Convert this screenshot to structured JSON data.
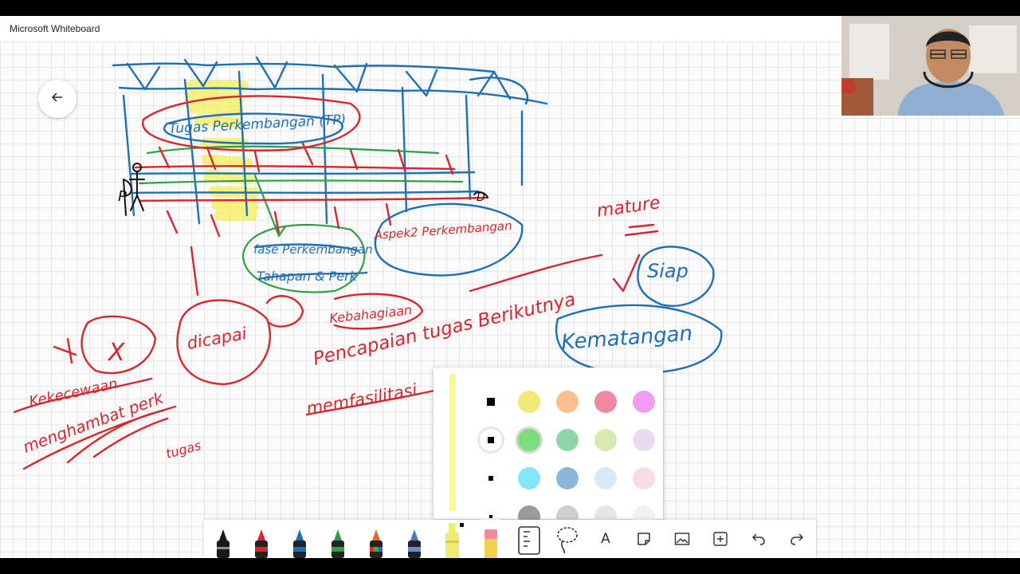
{
  "app": {
    "title": "Microsoft Whiteboard"
  },
  "canvas": {
    "ink_colors": {
      "red": "#d9262e",
      "blue": "#1f6fb5",
      "green": "#2e9e46",
      "yellow_highlight": "#f4ef5a",
      "black": "#111111"
    },
    "handwriting": [
      {
        "text": "Tugas Perkembangan (TP)",
        "color": "#1f6fb5"
      },
      {
        "text": "fase Perkembangan",
        "color": "#1f6fb5"
      },
      {
        "text": "Tahapan & Perk",
        "color": "#1f6fb5"
      },
      {
        "text": "Aspek2 Perkembangan",
        "color": "#d9262e"
      },
      {
        "text": "mature",
        "color": "#d9262e"
      },
      {
        "text": "Siap",
        "color": "#1f6fb5"
      },
      {
        "text": "Kematangan",
        "color": "#1f6fb5"
      },
      {
        "text": "dicapai",
        "color": "#d9262e"
      },
      {
        "text": "Kebahagiaan",
        "color": "#d9262e"
      },
      {
        "text": "Pencapaian tugas Berikutnya",
        "color": "#d9262e"
      },
      {
        "text": "memfasilitasi",
        "color": "#d9262e"
      },
      {
        "text": "Kekecewaan",
        "color": "#d9262e"
      },
      {
        "text": "menghambat perk",
        "color": "#d9262e"
      },
      {
        "text": "tugas",
        "color": "#d9262e"
      },
      {
        "text": "X",
        "color": "#d9262e"
      },
      {
        "text": "P",
        "color": "#111111"
      },
      {
        "text": "D",
        "color": "#111111"
      }
    ]
  },
  "palette": {
    "selected_color": "#f4ef5a",
    "sizes": [
      "thickest",
      "thick",
      "medium",
      "thin"
    ],
    "selected_size": "thick",
    "swatches": [
      [
        "#f1e87a",
        "#f9c08e",
        "#f08aa0",
        "#f29bf5"
      ],
      [
        "#7ddc7d",
        "#8fd6a6",
        "#d8eab0",
        "#eadbf5"
      ],
      [
        "#84e6f4",
        "#8bb6da",
        "#dbe8f6",
        "#f8dde6"
      ],
      [
        "#9b9b9b",
        "#cfcfcf",
        "#e6e6e6",
        "#f2f2f2"
      ]
    ]
  },
  "toolbar": {
    "tools": [
      {
        "name": "black-pen",
        "color": "#1a1a1a"
      },
      {
        "name": "red-pen",
        "color": "#d9262e"
      },
      {
        "name": "blue-pen",
        "color": "#1f6fb5"
      },
      {
        "name": "green-pen",
        "color": "#2e9e46"
      },
      {
        "name": "rainbow-pen",
        "color": "#e06a2a"
      },
      {
        "name": "galaxy-pen",
        "color": "#4a78b8"
      },
      {
        "name": "highlighter",
        "color": "#f4ef5a",
        "selected": true
      },
      {
        "name": "eraser",
        "color": "#f08aa0"
      },
      {
        "name": "ruler-icon"
      },
      {
        "name": "lasso-icon"
      },
      {
        "name": "text-icon",
        "label": "A"
      },
      {
        "name": "note-icon"
      },
      {
        "name": "image-icon"
      },
      {
        "name": "add-icon"
      },
      {
        "name": "undo-icon"
      },
      {
        "name": "redo-icon"
      }
    ]
  }
}
